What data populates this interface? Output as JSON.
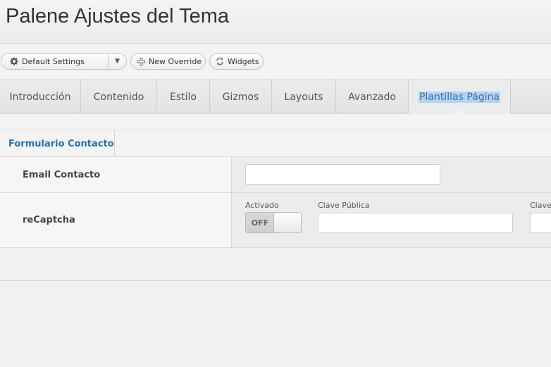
{
  "header": {
    "title": "Palene Ajustes del Tema"
  },
  "toolbar": {
    "settings_select": {
      "label": "Default Settings",
      "icon": "gear-icon"
    },
    "new_override": {
      "label": "New Override",
      "icon": "plus-icon"
    },
    "widgets": {
      "label": "Widgets",
      "icon": "refresh-icon"
    }
  },
  "tabs": [
    {
      "label": "Introducción"
    },
    {
      "label": "Contenido"
    },
    {
      "label": "Estilo"
    },
    {
      "label": "Gizmos"
    },
    {
      "label": "Layouts"
    },
    {
      "label": "Avanzado"
    },
    {
      "label": "Plantillas Página",
      "active": true
    }
  ],
  "subtabs": [
    {
      "label": "Formulario Contacto",
      "active": true
    }
  ],
  "form": {
    "email": {
      "label": "Email Contacto",
      "value": ""
    },
    "recaptcha": {
      "label": "reCaptcha",
      "enabled_label": "Activado",
      "toggle_state": "OFF",
      "public_key_label": "Clave Pública",
      "public_key_value": "",
      "private_key_label": "Clave",
      "private_key_value": ""
    }
  },
  "colors": {
    "accent": "#2a6fad",
    "tab_highlight": "#b6d4f2"
  }
}
